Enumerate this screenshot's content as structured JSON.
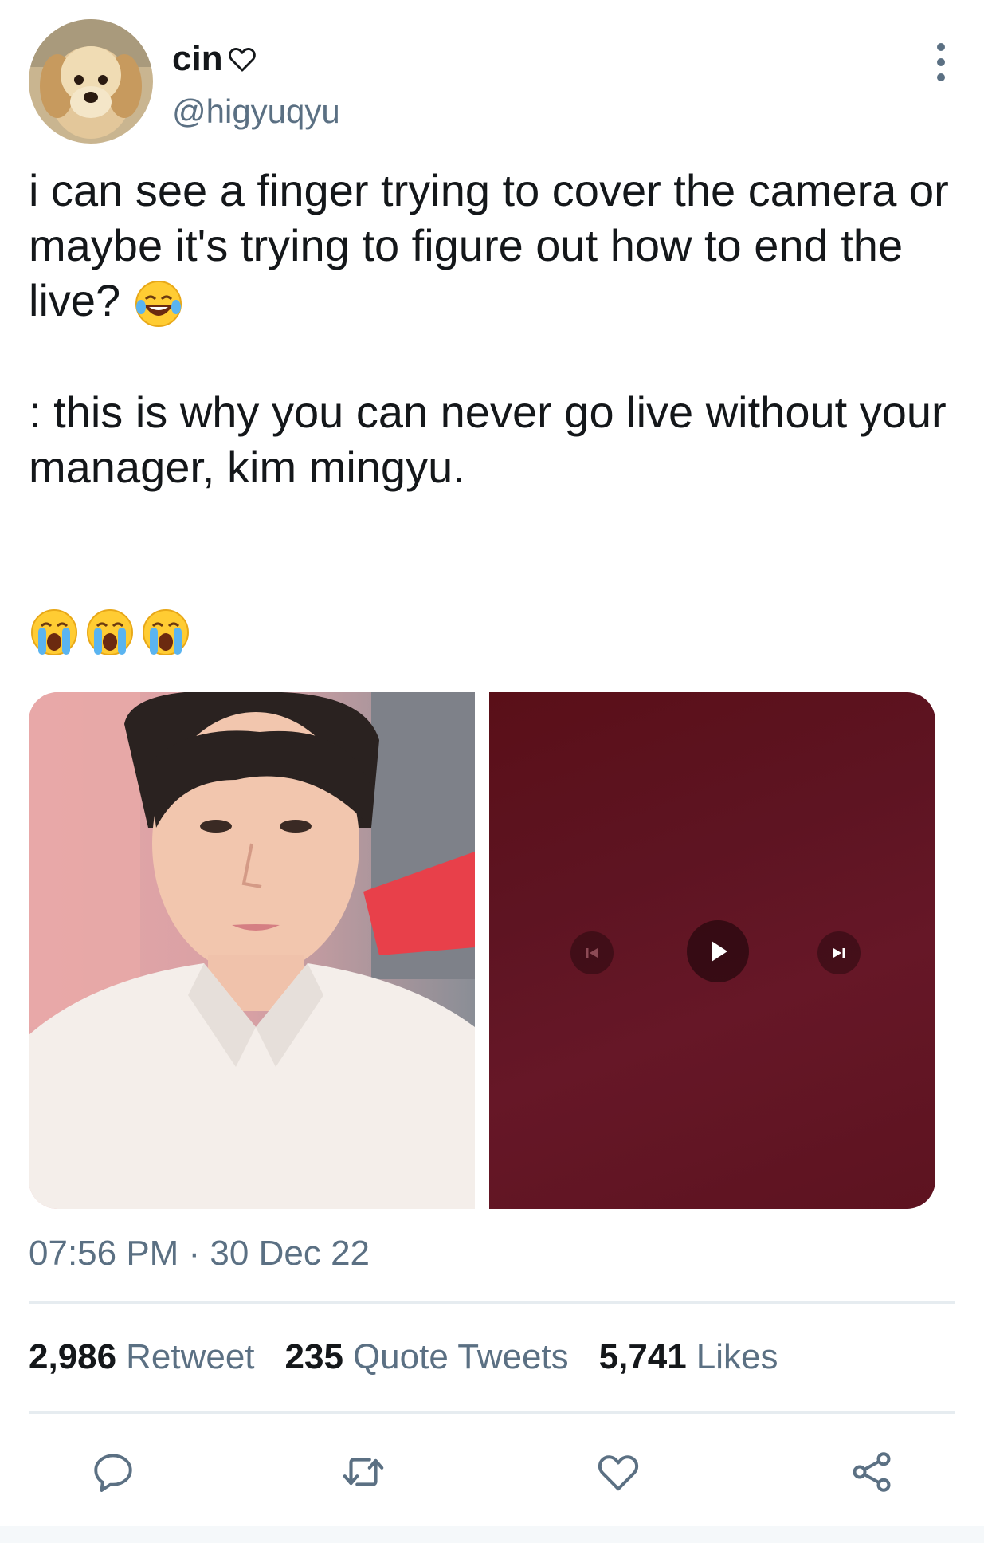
{
  "user": {
    "display_name": "cin",
    "handle": "@higyuqyu",
    "verified_heart": "heart-outline-icon"
  },
  "tweet": {
    "paragraphs": [
      "i can see a finger trying to cover the camera or maybe it's trying to figure out how to end the live?",
      ": this is why you can never go live without your manager, kim mingyu."
    ],
    "emojis_line1": [
      "face-with-tears-of-joy"
    ],
    "emojis_line3": [
      "loudly-crying-face",
      "loudly-crying-face",
      "loudly-crying-face"
    ]
  },
  "media": {
    "items": [
      {
        "type": "photo",
        "description_icon": "person-photo"
      },
      {
        "type": "video",
        "description_icon": "video-player"
      }
    ]
  },
  "meta": {
    "timestamp": "07:56 PM · 30 Dec 22"
  },
  "stats": {
    "retweets_count": "2,986",
    "retweets_label": "Retweet",
    "quotes_count": "235",
    "quotes_label": "Quote Tweets",
    "likes_count": "5,741",
    "likes_label": "Likes"
  },
  "actions": [
    "reply-icon",
    "retweet-icon",
    "like-icon",
    "share-icon"
  ],
  "colors": {
    "text_primary": "#14171a",
    "text_secondary": "#5b7083",
    "divider": "#e6ecf0",
    "video_bg": "#5e1422"
  }
}
